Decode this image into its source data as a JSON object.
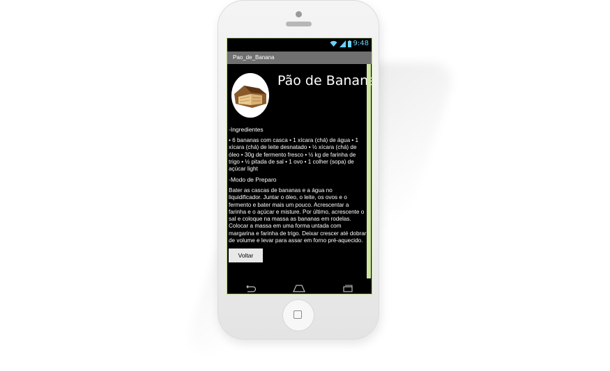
{
  "status": {
    "time": "9:48",
    "icons": [
      "wifi-icon",
      "signal-icon",
      "battery-icon"
    ],
    "accent": "#6bd1ff"
  },
  "app": {
    "title_bar": "Pao_de_Banana"
  },
  "recipe": {
    "title": "Pão de Banana",
    "image": "banana-bread-image",
    "ingredients_heading": "-Ingredientes",
    "ingredients_text": "• 6 bananas com casca • 1 xícara (chá) de água • 1 xícara (chá) de leite desnatado • ½ xícara (chá) de óleo • 30g de fermento fresco • ½ kg de farinha de trigo • ½ pitada de sal • 1 ovo • 1 colher (sopa) de açúcar light",
    "preparation_heading": "-Modo de Preparo",
    "preparation_text": "Bater as cascas de bananas e a água no liquidificador. Juntar o óleo, o leite, os ovos e o fermento e bater mais um pouco. Acrescentar a farinha e o açúcar e misture. Por último, acrescente o sal e coloque na massa as bananas em rodelas. Colocar a massa em uma forma untada com margarina e farinha de trigo. Deixar crescer até dobrar de volume e levar para assar em forno pré-aquecido."
  },
  "buttons": {
    "back": "Voltar"
  },
  "navigation": {
    "icons": [
      "back-icon",
      "home-icon",
      "recents-icon"
    ]
  },
  "colors": {
    "screen_bg": "#000000",
    "titlebar_bg": "#707070",
    "scrollbar": "#cfe6a2",
    "button_bg": "#e8e8e8"
  }
}
